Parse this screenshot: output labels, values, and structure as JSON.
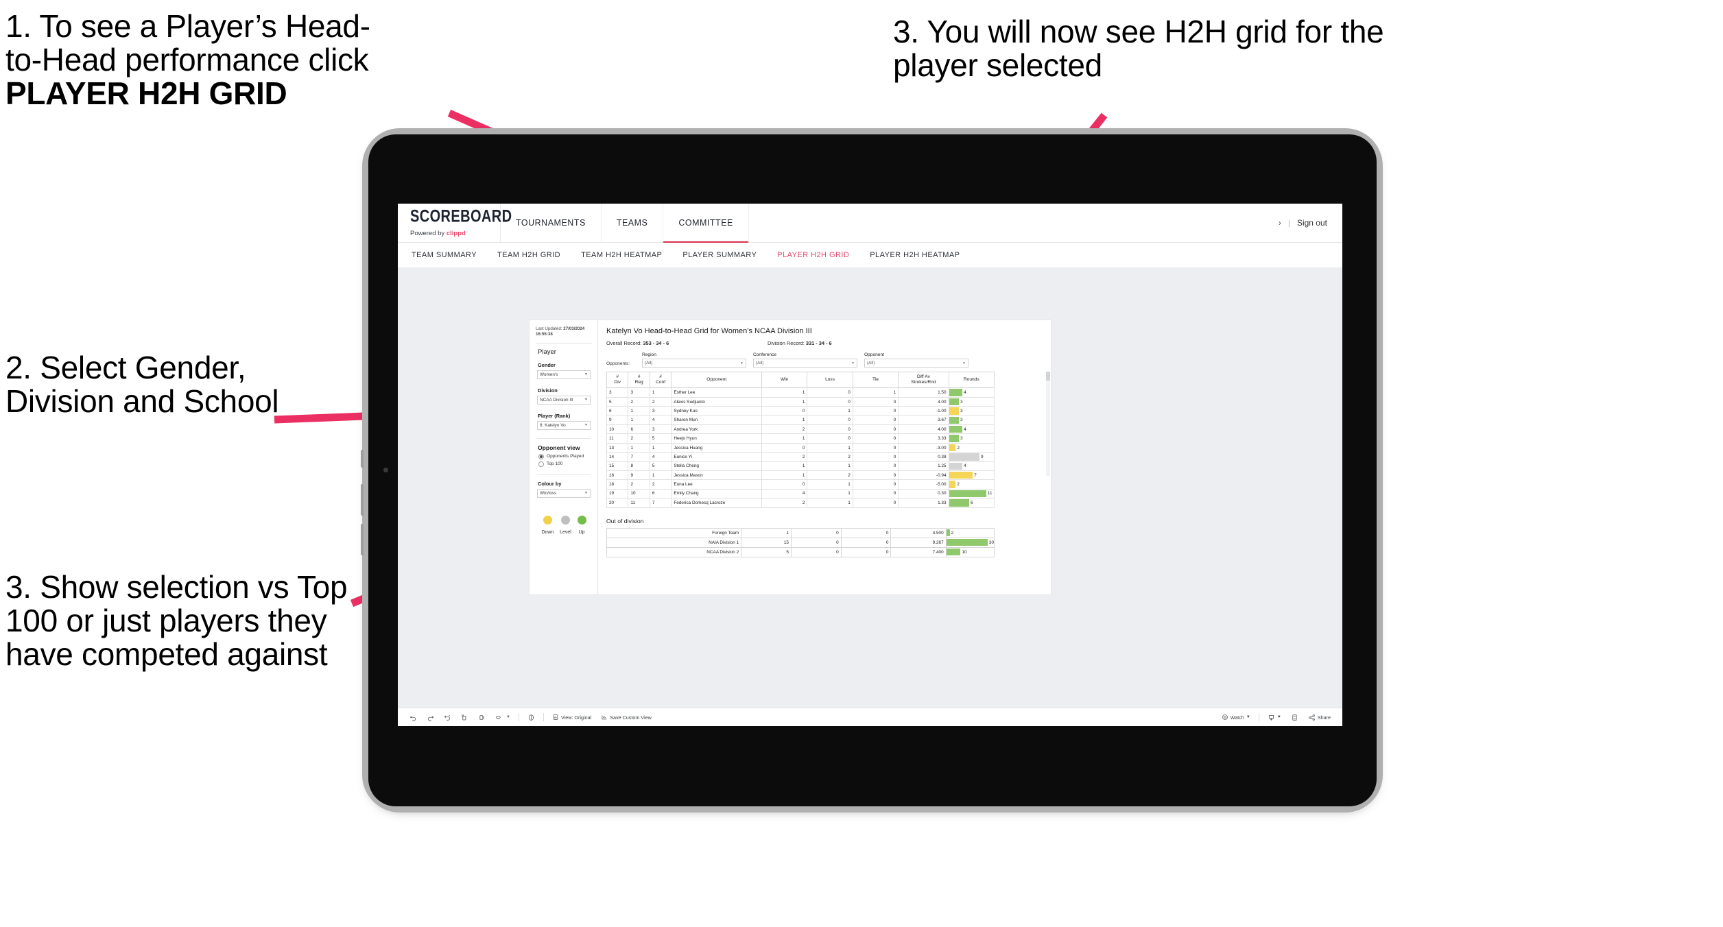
{
  "annotations": {
    "callout_1_line1": "1. To see a Player’s Head-",
    "callout_1_line2": "to-Head performance click",
    "callout_1_bold": "PLAYER H2H GRID",
    "callout_2": "2. Select Gender, Division and School",
    "callout_3": "3. Show selection vs Top 100 or just players they have competed against",
    "callout_4": "3. You will now see H2H grid for the player selected",
    "arrow_color": "#ec2f62"
  },
  "topbar": {
    "logo_main": "SCOREBOARD",
    "logo_sub_prefix": "Powered by ",
    "logo_sub_brand": "clippd",
    "nav": [
      {
        "label": "TOURNAMENTS",
        "active": false
      },
      {
        "label": "TEAMS",
        "active": false
      },
      {
        "label": "COMMITTEE",
        "active": true
      }
    ],
    "chevron": "›",
    "separator": "|",
    "sign_out": "Sign out"
  },
  "subnav": {
    "tabs": [
      {
        "label": "TEAM SUMMARY",
        "active": false
      },
      {
        "label": "TEAM H2H GRID",
        "active": false
      },
      {
        "label": "TEAM H2H HEATMAP",
        "active": false
      },
      {
        "label": "PLAYER SUMMARY",
        "active": false
      },
      {
        "label": "PLAYER H2H GRID",
        "active": true
      },
      {
        "label": "PLAYER H2H HEATMAP",
        "active": false
      }
    ],
    "active_color": "#e8486c"
  },
  "filters": {
    "last_updated_label": "Last Updated: ",
    "last_updated_value": "27/03/2024 16:55:38",
    "section_title": "Player",
    "gender": {
      "label": "Gender",
      "value": "Women's"
    },
    "division": {
      "label": "Division",
      "value": "NCAA Division III"
    },
    "player_rank": {
      "label": "Player (Rank)",
      "value": "8. Katelyn Vo"
    },
    "opponent_view": {
      "label": "Opponent view",
      "options": [
        {
          "label": "Opponents Played",
          "selected": true
        },
        {
          "label": "Top 100",
          "selected": false
        }
      ]
    },
    "colour_by": {
      "label": "Colour by",
      "value": "Win/loss"
    },
    "legend": [
      {
        "label": "Down",
        "color": "#f2d14a"
      },
      {
        "label": "Level",
        "color": "#bfbfbf"
      },
      {
        "label": "Up",
        "color": "#76bd4a"
      }
    ]
  },
  "viz": {
    "title": "Katelyn Vo Head-to-Head Grid for Women’s NCAA Division III",
    "overall_record_label": "Overall Record: ",
    "overall_record_value": "353 -  34 - 6",
    "division_record_label": "Division Record: ",
    "division_record_value": "331 -  34 - 6",
    "opponents_word": "Opponents:",
    "opponent_filters": [
      {
        "label": "Region",
        "value": "(All)"
      },
      {
        "label": "Conference",
        "value": "(All)"
      },
      {
        "label": "Opponent",
        "value": "(All)"
      }
    ],
    "columns": [
      "#\nDiv",
      "#\nReg",
      "#\nConf",
      "Opponent",
      "Win",
      "Loss",
      "Tie",
      "Diff Av\nStrokes/Rnd",
      "Rounds"
    ],
    "column_labels": {
      "div_top": "#",
      "div_bot": "Div",
      "reg_top": "#",
      "reg_bot": "Reg",
      "conf_top": "#",
      "conf_bot": "Conf",
      "opponent": "Opponent",
      "win": "Win",
      "loss": "Loss",
      "tie": "Tie",
      "diff_top": "Diff Av",
      "diff_bot": "Strokes/Rnd",
      "rounds": "Rounds"
    },
    "rows": [
      {
        "div": "3",
        "reg": "3",
        "conf": "1",
        "opponent": "Esther Lee",
        "win": "1",
        "loss": "0",
        "tie": "1",
        "diff": "1.50",
        "rounds": "4",
        "color": "g",
        "bar_pct": 30
      },
      {
        "div": "5",
        "reg": "2",
        "conf": "2",
        "opponent": "Alexis Sudjianto",
        "win": "1",
        "loss": "0",
        "tie": "0",
        "diff": "4.00",
        "rounds": "3",
        "color": "g",
        "bar_pct": 22
      },
      {
        "div": "6",
        "reg": "1",
        "conf": "3",
        "opponent": "Sydney Kuo",
        "win": "0",
        "loss": "1",
        "tie": "0",
        "diff": "-1.00",
        "rounds": "3",
        "color": "y",
        "bar_pct": 22
      },
      {
        "div": "9",
        "reg": "1",
        "conf": "4",
        "opponent": "Sharon Mun",
        "win": "1",
        "loss": "0",
        "tie": "0",
        "diff": "3.67",
        "rounds": "3",
        "color": "g",
        "bar_pct": 22
      },
      {
        "div": "10",
        "reg": "6",
        "conf": "3",
        "opponent": "Andrea York",
        "win": "2",
        "loss": "0",
        "tie": "0",
        "diff": "4.00",
        "rounds": "4",
        "color": "g",
        "bar_pct": 30
      },
      {
        "div": "11",
        "reg": "2",
        "conf": "5",
        "opponent": "Heejo Hyun",
        "win": "1",
        "loss": "0",
        "tie": "0",
        "diff": "3.33",
        "rounds": "3",
        "color": "g",
        "bar_pct": 22
      },
      {
        "div": "13",
        "reg": "1",
        "conf": "1",
        "opponent": "Jessica Huang",
        "win": "0",
        "loss": "1",
        "tie": "0",
        "diff": "-3.00",
        "rounds": "2",
        "color": "y",
        "bar_pct": 15
      },
      {
        "div": "14",
        "reg": "7",
        "conf": "4",
        "opponent": "Eunice Yi",
        "win": "2",
        "loss": "2",
        "tie": "0",
        "diff": "0.38",
        "rounds": "9",
        "color": "n",
        "bar_pct": 68
      },
      {
        "div": "15",
        "reg": "8",
        "conf": "5",
        "opponent": "Stella Cheng",
        "win": "1",
        "loss": "1",
        "tie": "0",
        "diff": "1.25",
        "rounds": "4",
        "color": "n",
        "bar_pct": 30
      },
      {
        "div": "16",
        "reg": "9",
        "conf": "1",
        "opponent": "Jessica Mason",
        "win": "1",
        "loss": "2",
        "tie": "0",
        "diff": "-0.94",
        "rounds": "7",
        "color": "y",
        "bar_pct": 53
      },
      {
        "div": "18",
        "reg": "2",
        "conf": "2",
        "opponent": "Euna Lee",
        "win": "0",
        "loss": "1",
        "tie": "0",
        "diff": "-5.00",
        "rounds": "2",
        "color": "y",
        "bar_pct": 15
      },
      {
        "div": "19",
        "reg": "10",
        "conf": "6",
        "opponent": "Emily Chang",
        "win": "4",
        "loss": "1",
        "tie": "0",
        "diff": "0.30",
        "rounds": "11",
        "color": "g",
        "bar_pct": 83
      },
      {
        "div": "20",
        "reg": "11",
        "conf": "7",
        "opponent": "Federica Domecq Lacroze",
        "win": "2",
        "loss": "1",
        "tie": "0",
        "diff": "1.33",
        "rounds": "6",
        "color": "g",
        "bar_pct": 45
      }
    ],
    "out_of_division": {
      "title": "Out of division",
      "rows": [
        {
          "name": "Foreign Team",
          "win": "1",
          "loss": "0",
          "tie": "0",
          "diff": "4.500",
          "rounds": "2",
          "color": "g",
          "bar_pct": 7
        },
        {
          "name": "NAIA Division 1",
          "win": "15",
          "loss": "0",
          "tie": "0",
          "diff": "9.267",
          "rounds": "30",
          "color": "g",
          "bar_pct": 92
        },
        {
          "name": "NCAA Division 2",
          "win": "5",
          "loss": "0",
          "tie": "0",
          "diff": "7.400",
          "rounds": "10",
          "color": "g",
          "bar_pct": 30
        }
      ]
    },
    "colors": {
      "up": "#8fc96c",
      "down": "#f4d558",
      "level": "#d4d4d4"
    }
  },
  "toolbar": {
    "undo": "undo-icon",
    "redo": "redo-icon",
    "revert": "revert-icon",
    "refresh": "refresh-data-icon",
    "pause": "pause-updates-icon",
    "view_original_label": "View: Original",
    "save_custom_view_label": "Save Custom View",
    "watch_label": "Watch",
    "download_label": "download-icon",
    "fullscreen_label": "fullscreen-icon",
    "share_label": "Share"
  }
}
